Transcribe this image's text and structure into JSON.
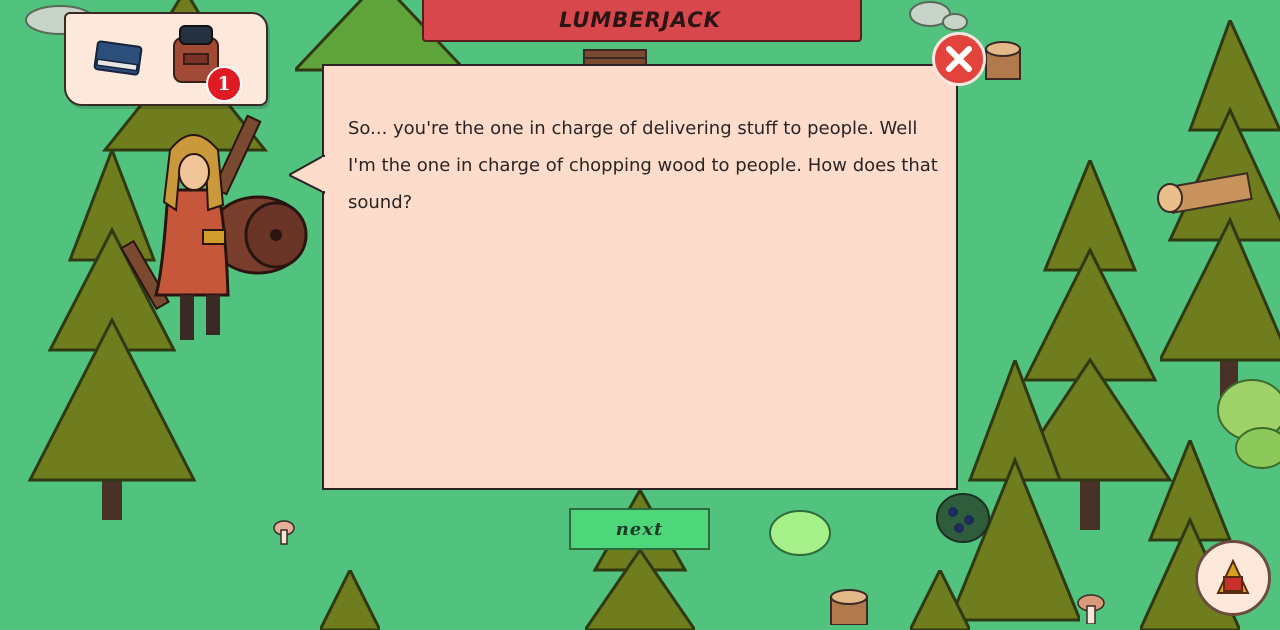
{
  "dialog": {
    "speaker": "LUMBERJACK",
    "lines": [
      "So... you're the one in charge of delivering stuff to people. Well",
      "I'm the one in charge of chopping wood to people. How does that",
      "sound?"
    ],
    "next_label": "next"
  },
  "inventory": {
    "items": [
      {
        "icon": "book-icon"
      },
      {
        "icon": "backpack-icon",
        "badge": "1"
      }
    ]
  },
  "colors": {
    "grass": "#52c27f",
    "dialog_bg": "#fddccb",
    "banner": "#d7474c",
    "close": "#e2433c",
    "next": "#4ed67a",
    "badge": "#e01b23"
  }
}
